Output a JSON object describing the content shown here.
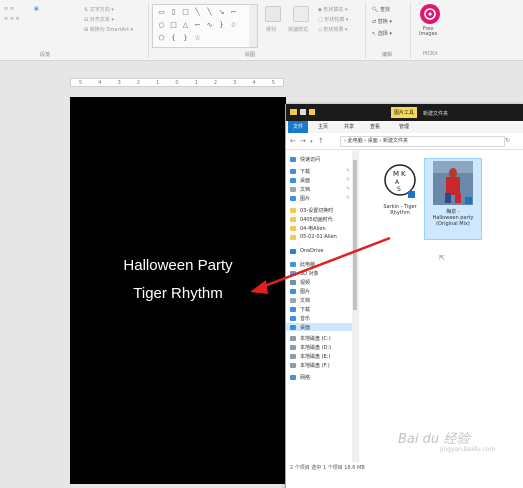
{
  "ribbon": {
    "clipboard_items": [
      "",
      "",
      ""
    ],
    "insert_shape_label": "",
    "shape_format_label": "",
    "find_label": "查找",
    "replace_label": "替换",
    "select_label": "选择",
    "arrange_label": "排列",
    "quick_styles_label": "快速样式",
    "group_labels": {
      "paragraph": "段落",
      "drawing": "绘图",
      "editing": "编辑",
      "pixel": "PICKit"
    },
    "free_images": "Free\nImages"
  },
  "ruler": {
    "ticks": [
      "5",
      "4",
      "3",
      "2",
      "1",
      "0",
      "1",
      "2",
      "3",
      "4",
      "5"
    ]
  },
  "slide": {
    "line1": "Halloween Party",
    "line2": "Tiger Rhythm",
    "background": "#000000",
    "text_color": "#ffffff"
  },
  "explorer": {
    "context_tab": "图片工具",
    "window_title": "新建文件夹",
    "tabs": {
      "file": "文件",
      "home": "主页",
      "share": "共享",
      "view": "查看",
      "manage": "管理"
    },
    "address": "› 此电脑 › 桌面 › 新建文件夹",
    "nav": [
      {
        "label": "快速访问",
        "icon": "star-icon",
        "color": "#3a8ee6",
        "pinned": false
      },
      {
        "label": "下载",
        "icon": "download-icon",
        "color": "#3a8ee6",
        "pinned": true
      },
      {
        "label": "桌面",
        "icon": "desktop-icon",
        "color": "#3a8ee6",
        "pinned": true
      },
      {
        "label": "文档",
        "icon": "document-icon",
        "color": "#9aa6b2",
        "pinned": true
      },
      {
        "label": "图片",
        "icon": "picture-icon",
        "color": "#3a8ee6",
        "pinned": true
      },
      {
        "label": "03-设置切换时",
        "icon": "folder-icon",
        "color": "#f2c94c",
        "pinned": false
      },
      {
        "label": "0405动画时代",
        "icon": "folder-icon",
        "color": "#f2c94c",
        "pinned": false
      },
      {
        "label": "04-电Alien",
        "icon": "folder-icon",
        "color": "#f2c94c",
        "pinned": false
      },
      {
        "label": "05-02-01-Alien",
        "icon": "folder-icon",
        "color": "#f2c94c",
        "pinned": false
      },
      {
        "label": "OneDrive",
        "icon": "cloud-icon",
        "color": "#2d7fd3",
        "pinned": false
      },
      {
        "label": "此电脑",
        "icon": "computer-icon",
        "color": "#4a90d9",
        "pinned": false
      },
      {
        "label": "3D 对象",
        "icon": "cube-icon",
        "color": "#5aa0e0",
        "pinned": false
      },
      {
        "label": "视频",
        "icon": "video-icon",
        "color": "#7b8b99",
        "pinned": false
      },
      {
        "label": "图片",
        "icon": "picture-icon",
        "color": "#3a8ee6",
        "pinned": false
      },
      {
        "label": "文档",
        "icon": "document-icon",
        "color": "#9aa6b2",
        "pinned": false
      },
      {
        "label": "下载",
        "icon": "download-icon",
        "color": "#3a8ee6",
        "pinned": false
      },
      {
        "label": "音乐",
        "icon": "music-icon",
        "color": "#3a8ee6",
        "pinned": false
      },
      {
        "label": "桌面",
        "icon": "desktop-icon",
        "color": "#3a8ee6",
        "pinned": false,
        "selected": true
      },
      {
        "label": "本地磁盘 (C:)",
        "icon": "drive-icon",
        "color": "#8a9bb0",
        "pinned": false
      },
      {
        "label": "本地磁盘 (D:)",
        "icon": "drive-icon",
        "color": "#8a9bb0",
        "pinned": false
      },
      {
        "label": "本地磁盘 (E:)",
        "icon": "drive-icon",
        "color": "#8a9bb0",
        "pinned": false
      },
      {
        "label": "本地磁盘 (F:)",
        "icon": "drive-icon",
        "color": "#8a9bb0",
        "pinned": false
      },
      {
        "label": "网络",
        "icon": "network-icon",
        "color": "#4a90d9",
        "pinned": false
      }
    ],
    "files": [
      {
        "name_line1": "Sarkin - Tiger",
        "name_line2": "Rhythm",
        "type": "audio"
      },
      {
        "name_line1": "梅泉 -",
        "name_line2": "Halloween party (Original Mix)",
        "type": "image"
      }
    ],
    "status": "2 个项目    选中 1 个项目  16.6 MB"
  },
  "watermark": {
    "brand": "Bai du 经验",
    "sub": "jingyan.baidu.com"
  },
  "accent": {
    "arrow_color": "#e02020",
    "explorer_blue": "#1979ca"
  }
}
